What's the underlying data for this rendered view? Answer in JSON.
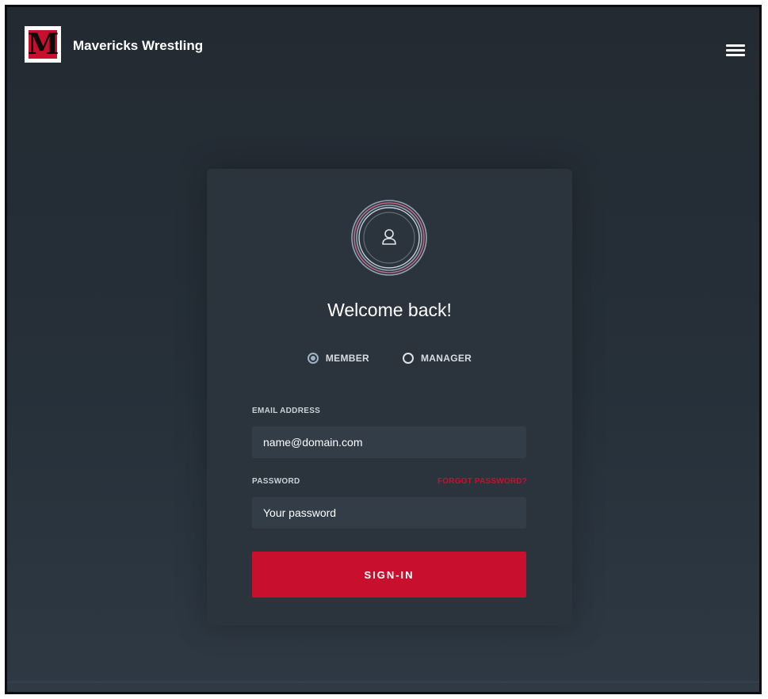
{
  "header": {
    "logo_letter": "M",
    "brand": "Mavericks Wrestling",
    "menu_icon": "hamburger-menu-icon"
  },
  "login": {
    "avatar_icon": "user-icon",
    "welcome": "Welcome back!",
    "roles": [
      {
        "label": "MEMBER",
        "selected": true
      },
      {
        "label": "MANAGER",
        "selected": false
      }
    ],
    "email_label": "EMAIL ADDRESS",
    "email_placeholder": "name@domain.com",
    "password_label": "PASSWORD",
    "forgot_label": "FORGOT PASSWORD?",
    "password_placeholder": "Your password",
    "signin_label": "SIGN-IN"
  },
  "colors": {
    "accent": "#c8102e",
    "background": "#252d35",
    "card": "#2b333c",
    "input": "#323d47"
  }
}
